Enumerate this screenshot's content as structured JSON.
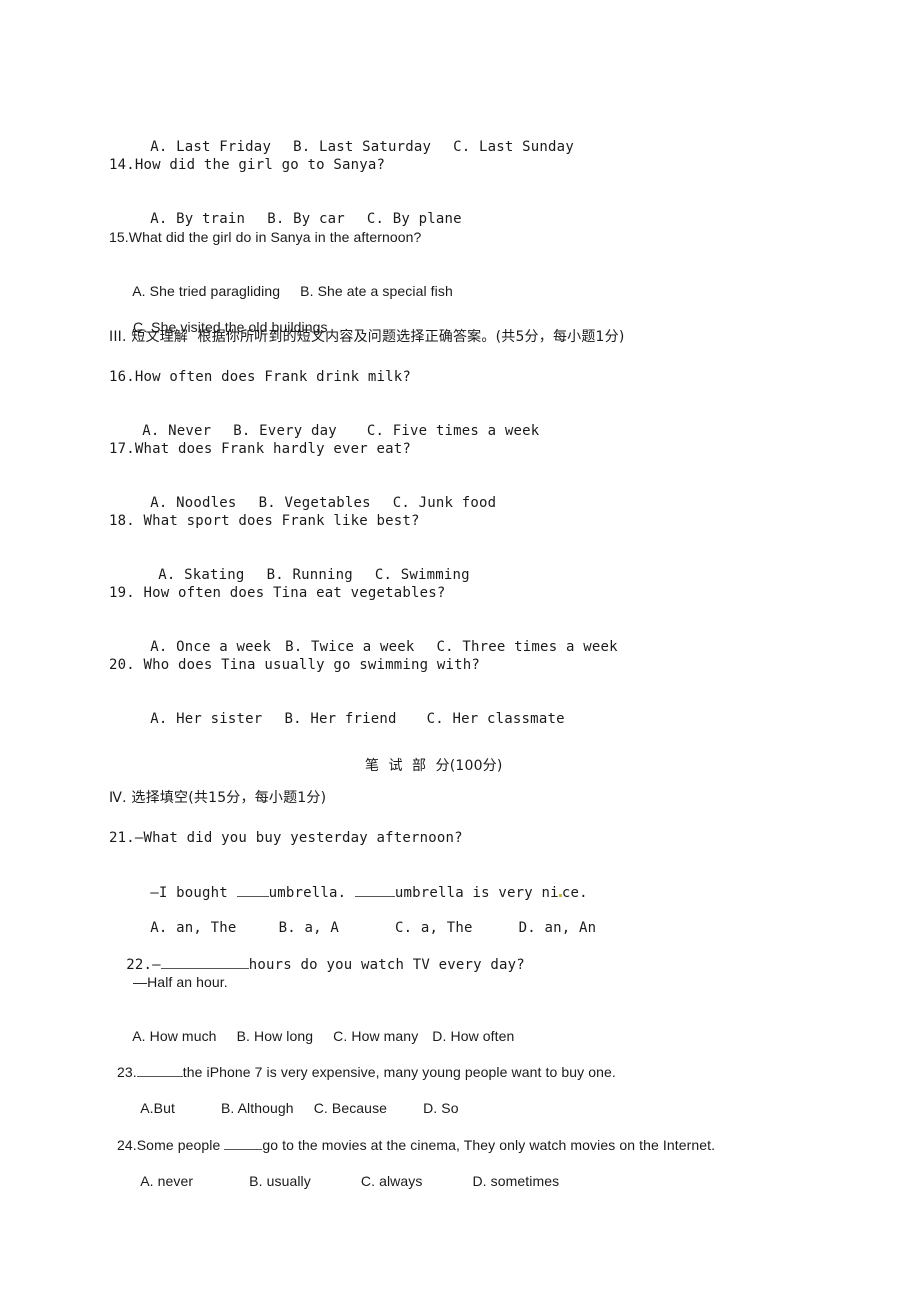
{
  "q13": {
    "options": [
      "A. Last Friday",
      "B. Last Saturday",
      "C. Last Sunday"
    ]
  },
  "q14": {
    "question": "14.How did the girl go to Sanya?",
    "options": [
      "A. By train",
      "B. By car",
      "C. By plane"
    ]
  },
  "q15": {
    "question": "15.What did the girl do in Sanya in the afternoon?",
    "options": [
      "A. She tried paragliding",
      "B. She ate a special fish",
      "C. She visited the old buildings"
    ]
  },
  "section3": {
    "heading": "III. 短文理解  根据你所听到的短文内容及问题选择正确答案。(共5分，每小题1分)"
  },
  "q16": {
    "question": "16.How often does Frank drink milk?",
    "options": [
      "A. Never",
      "B. Every day",
      "C. Five times a week"
    ]
  },
  "q17": {
    "question": "17.What does Frank hardly ever eat?",
    "options": [
      "A. Noodles",
      "B. Vegetables",
      "C. Junk food"
    ]
  },
  "q18": {
    "question": "18. What sport does Frank like best?",
    "options": [
      "A. Skating",
      "B. Running",
      "C. Swimming"
    ]
  },
  "q19": {
    "question": "19. How often does Tina eat vegetables?",
    "options": [
      "A. Once a week",
      "B. Twice a week",
      "C. Three times a week"
    ]
  },
  "q20": {
    "question": "20. Who does Tina usually go swimming with?",
    "options": [
      "A. Her sister",
      "B. Her friend",
      "C. Her classmate"
    ]
  },
  "written_part": {
    "title": "笔  试  部  分(100分)"
  },
  "section4": {
    "heading": "Ⅳ. 选择填空(共15分，每小题1分)"
  },
  "q21": {
    "question": "21.—What did you buy yesterday afternoon?",
    "reply_prefix": "—I bought ",
    "reply_mid": "umbrella. ",
    "reply_suffix_a": "umbrella is very ni",
    "reply_suffix_b": "ce.",
    "options": [
      "A. an, The",
      "B. a, A",
      "C. a, The",
      "D. an, An"
    ]
  },
  "q22": {
    "prefix": "22.—",
    "question": "hours do you watch TV every day?",
    "reply": "—Half an hour.",
    "options": [
      "A. How much",
      "B. How long",
      "C. How many",
      "D. How often"
    ]
  },
  "q23": {
    "prefix": "23.",
    "question": "the iPhone 7 is very expensive, many young people want to buy one.",
    "options": [
      "A.But",
      "B. Although",
      "C. Because",
      "D. So"
    ]
  },
  "q24": {
    "prefix": "24.Some people ",
    "question": "go to the movies at the cinema, They only watch movies on the Internet.",
    "options": [
      "A. never",
      "B. usually",
      "C. always",
      "D. sometimes"
    ]
  }
}
